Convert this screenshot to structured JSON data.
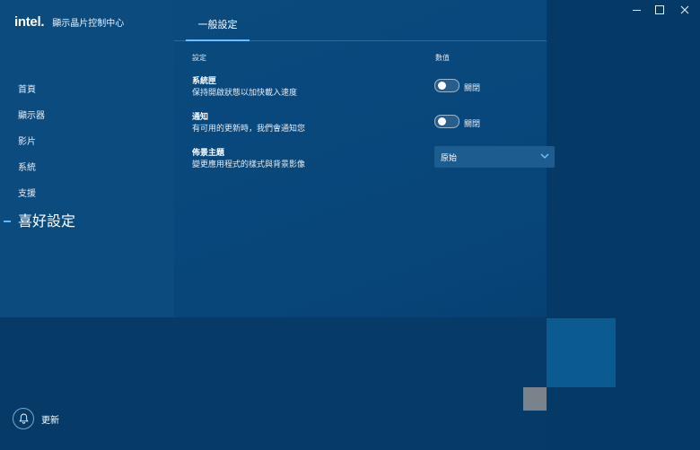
{
  "app": {
    "logo": "intel.",
    "title": "顯示晶片控制中心"
  },
  "sidebar": {
    "items": [
      {
        "label": "首頁"
      },
      {
        "label": "顯示器"
      },
      {
        "label": "影片"
      },
      {
        "label": "系統"
      },
      {
        "label": "支援"
      },
      {
        "label": "喜好設定",
        "active": true
      }
    ],
    "update_label": "更新"
  },
  "header": {
    "tab": "一般設定"
  },
  "table": {
    "col_setting": "設定",
    "col_value": "數值",
    "rows": [
      {
        "title": "系統匣",
        "desc": "保持開啟狀態以加快載入速度",
        "control": "toggle",
        "value": "關閉"
      },
      {
        "title": "通知",
        "desc": "有可用的更新時，我們會通知您",
        "control": "toggle",
        "value": "關閉"
      },
      {
        "title": "佈景主題",
        "desc": "變更應用程式的樣式與背景影像",
        "control": "select",
        "value": "原始"
      }
    ]
  },
  "colors": {
    "accent": "#5fb5ff",
    "background": "#073a66"
  }
}
